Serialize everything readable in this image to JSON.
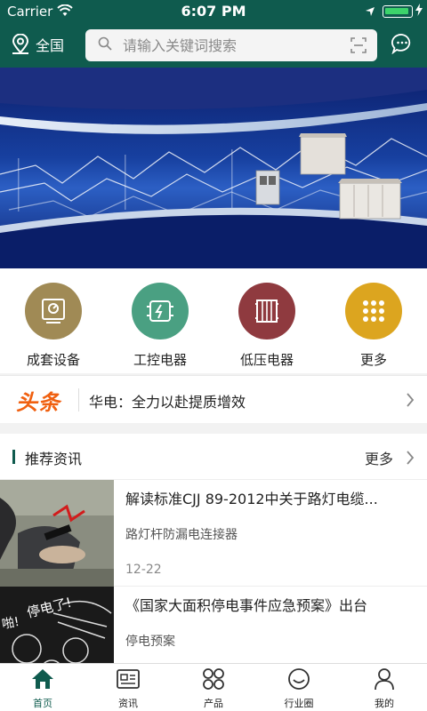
{
  "status_bar": {
    "carrier": "Carrier",
    "time": "6:07 PM"
  },
  "header": {
    "city": "全国",
    "search_placeholder": "请输入关键词搜索"
  },
  "categories": [
    {
      "label": "成套设备",
      "color": "#a08a55",
      "icon": "monitor-icon"
    },
    {
      "label": "工控电器",
      "color": "#4aa082",
      "icon": "controller-icon"
    },
    {
      "label": "低压电器",
      "color": "#8f3a3f",
      "icon": "electric-box-icon"
    },
    {
      "label": "更多",
      "color": "#dca51f",
      "icon": "grid-dots-icon"
    }
  ],
  "headline": {
    "brand": "头条",
    "text": "华电：全力以赴提质增效"
  },
  "recommended": {
    "title": "推荐资讯",
    "more": "更多",
    "items": [
      {
        "title": "解读标准CJJ 89-2012中关于路灯电缆...",
        "subtitle": "路灯杆防漏电连接器",
        "date": "12-22"
      },
      {
        "title": "《国家大面积停电事件应急预案》出台",
        "subtitle": "停电预案",
        "date": ""
      }
    ]
  },
  "tabs": [
    {
      "label": "首页",
      "icon": "home-icon",
      "active": true
    },
    {
      "label": "资讯",
      "icon": "news-icon",
      "active": false
    },
    {
      "label": "产品",
      "icon": "products-icon",
      "active": false
    },
    {
      "label": "行业圈",
      "icon": "circle-icon",
      "active": false
    },
    {
      "label": "我的",
      "icon": "user-icon",
      "active": false
    }
  ],
  "colors": {
    "brand": "#0f5b4e",
    "headline_brand": "#f06010"
  }
}
